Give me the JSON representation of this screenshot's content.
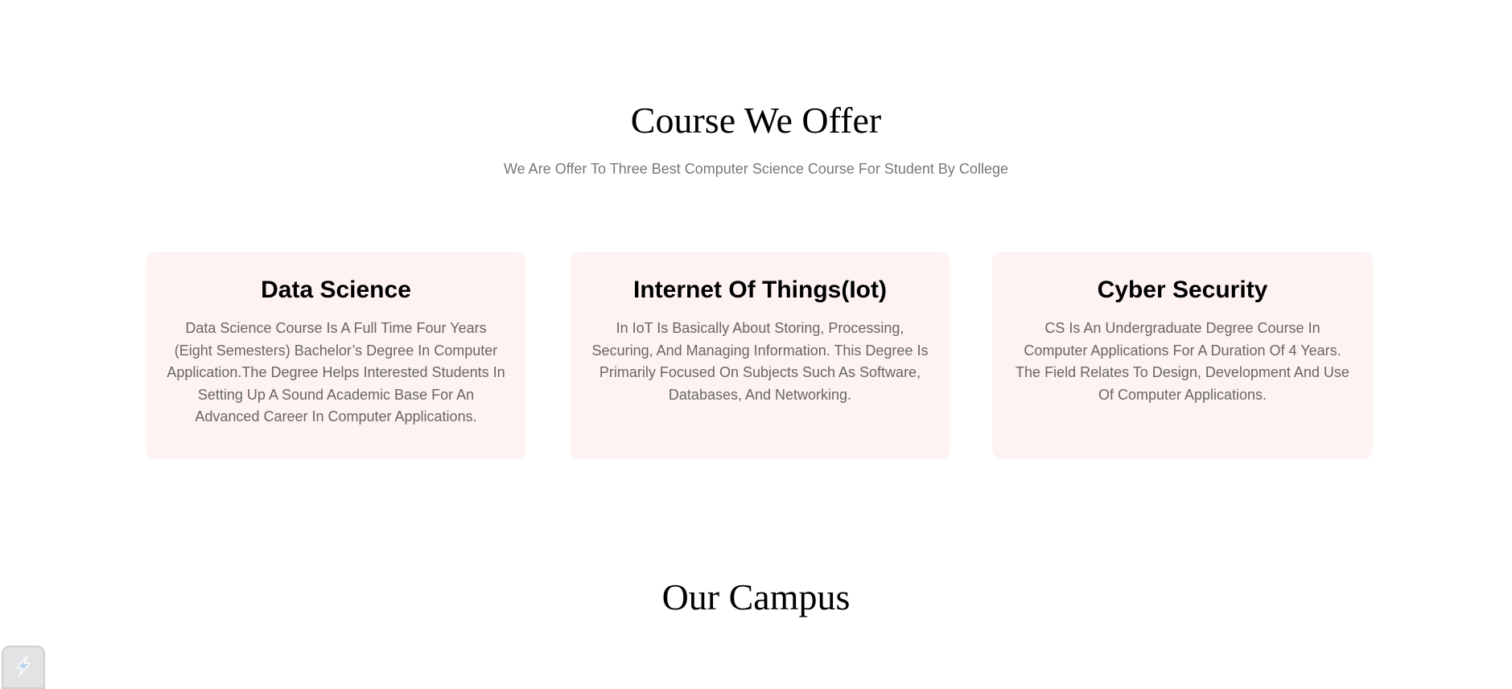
{
  "courses_section": {
    "title": "Course We Offer",
    "subtitle": "We Are Offer To Three Best Computer Science Course For Student By College",
    "cards": [
      {
        "title": "Data Science",
        "description": "Data Science Course Is A Full Time Four Years (Eight Semesters) Bachelor’s Degree In Computer Application.The Degree Helps Interested Students In Setting Up A Sound Academic Base For An Advanced Career In Computer Applications."
      },
      {
        "title": "Internet Of Things(Iot)",
        "description": "In IoT Is Basically About Storing, Processing, Securing, And Managing Information. This Degree Is Primarily Focused On Subjects Such As Software, Databases, And Networking."
      },
      {
        "title": "Cyber Security",
        "description": "CS Is An Undergraduate Degree Course In Computer Applications For A Duration Of 4 Years. The Field Relates To Design, Development And Use Of Computer Applications."
      }
    ]
  },
  "campus_section": {
    "title": "Our Campus"
  },
  "corner_widget": {
    "icon": "lightning-bolt-icon"
  },
  "colors": {
    "card_background": "#fff2f2",
    "subtitle_text": "#777777",
    "card_text": "#666666"
  }
}
